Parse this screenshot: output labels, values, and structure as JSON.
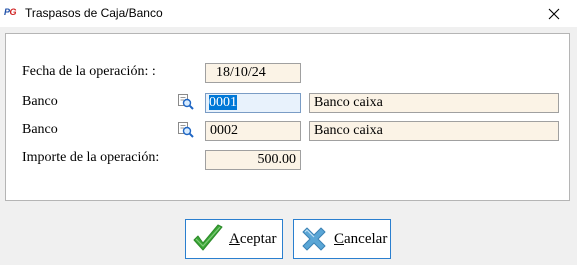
{
  "window": {
    "title": "Traspasos de Caja/Banco",
    "icon_text": "PG"
  },
  "form": {
    "fecha": {
      "label": "Fecha de la operación: :",
      "value": "18/10/24"
    },
    "banco1": {
      "label": "Banco",
      "code": "0001",
      "name": "Banco caixa"
    },
    "banco2": {
      "label": "Banco",
      "code": "0002",
      "name": "Banco caixa"
    },
    "importe": {
      "label": "Importe de la operación:",
      "value": "500.00"
    }
  },
  "buttons": {
    "accept": {
      "label": "Aceptar",
      "icon": "checkmark-icon",
      "color": "#3aa635"
    },
    "cancel": {
      "label": "Cancelar",
      "icon": "x-icon",
      "color": "#5aa6d6"
    }
  },
  "colors": {
    "field_bg": "#fbf3e6",
    "active_field_bg": "#e8f2fc",
    "selection": "#0078d7",
    "button_border": "#2a7fcf"
  }
}
